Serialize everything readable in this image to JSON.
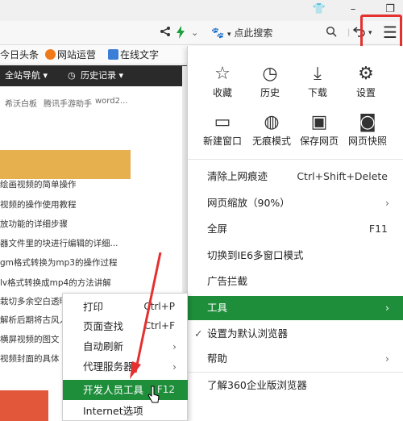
{
  "window": {
    "shirt_icon": "👕",
    "minimize": "–",
    "restore": "❐"
  },
  "addressbar": {
    "search_label": "点此搜索"
  },
  "bookmarks": [
    {
      "label": "今日头条"
    },
    {
      "label": "网站运营"
    },
    {
      "label": "在线文字"
    }
  ],
  "page": {
    "nav": [
      {
        "label": "全站导航 ▾"
      },
      {
        "label": "历史记录 ▾"
      }
    ],
    "links": [
      "希沃白板",
      "腾讯手游助手",
      "word2..."
    ],
    "articles": [
      "绘画视频的简单操作",
      "视频的操作使用教程",
      "放功能的详细步骤",
      "器文件里的块进行编辑的详细...",
      "gm格式转换为mp3的操作过程",
      "lv格式转换成mp4的方法讲解",
      "栽切多余空白透明",
      "解析后期将古风人",
      "横屏视频的图文",
      "视频封面的具体"
    ]
  },
  "menu": {
    "quick_row1": [
      {
        "icon": "☆",
        "label": "收藏"
      },
      {
        "icon": "◷",
        "label": "历史"
      },
      {
        "icon": "⤓",
        "label": "下载"
      },
      {
        "icon": "⚙",
        "label": "设置"
      }
    ],
    "quick_row2": [
      {
        "icon": "▭",
        "label": "新建窗口"
      },
      {
        "icon": "◍",
        "label": "无痕模式"
      },
      {
        "icon": "▣",
        "label": "保存网页"
      },
      {
        "icon": "◙",
        "label": "网页快照"
      }
    ],
    "items": {
      "clear_traces": {
        "label": "清除上网痕迹",
        "shortcut": "Ctrl+Shift+Delete"
      },
      "zoom": {
        "label": "网页缩放（90%）",
        "arrow": "›"
      },
      "fullscreen": {
        "label": "全屏",
        "shortcut": "F11"
      },
      "ie6": {
        "label": "切换到IE6多窗口模式"
      },
      "adblock": {
        "label": "广告拦截"
      },
      "tools": {
        "label": "工具",
        "arrow": "›"
      },
      "default_browser": {
        "label": "设置为默认浏览器",
        "check": "✓"
      },
      "help": {
        "label": "帮助",
        "arrow": "›"
      },
      "enterprise": {
        "label": "了解360企业版浏览器"
      }
    }
  },
  "submenu": {
    "print": {
      "label": "打印",
      "shortcut": "Ctrl+P"
    },
    "find": {
      "label": "页面查找",
      "shortcut": "Ctrl+F"
    },
    "autorefresh": {
      "label": "自动刷新",
      "arrow": "›"
    },
    "proxy": {
      "label": "代理服务器",
      "arrow": "›"
    },
    "devtools": {
      "label": "开发人员工具",
      "shortcut": "F12"
    },
    "internet_options": {
      "label": "Internet选项"
    }
  }
}
